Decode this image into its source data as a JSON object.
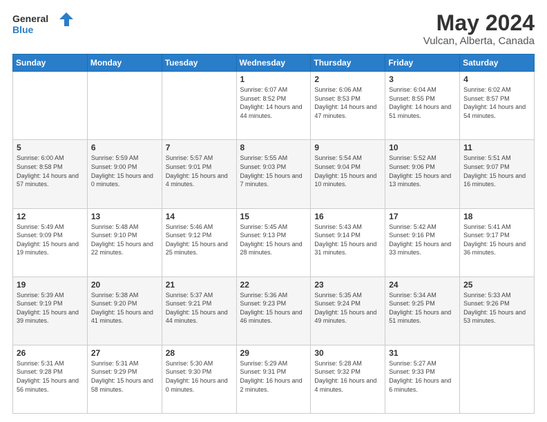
{
  "logo": {
    "line1": "General",
    "line2": "Blue"
  },
  "title": "May 2024",
  "subtitle": "Vulcan, Alberta, Canada",
  "weekdays": [
    "Sunday",
    "Monday",
    "Tuesday",
    "Wednesday",
    "Thursday",
    "Friday",
    "Saturday"
  ],
  "weeks": [
    [
      {
        "day": "",
        "sunrise": "",
        "sunset": "",
        "daylight": ""
      },
      {
        "day": "",
        "sunrise": "",
        "sunset": "",
        "daylight": ""
      },
      {
        "day": "",
        "sunrise": "",
        "sunset": "",
        "daylight": ""
      },
      {
        "day": "1",
        "sunrise": "Sunrise: 6:07 AM",
        "sunset": "Sunset: 8:52 PM",
        "daylight": "Daylight: 14 hours and 44 minutes."
      },
      {
        "day": "2",
        "sunrise": "Sunrise: 6:06 AM",
        "sunset": "Sunset: 8:53 PM",
        "daylight": "Daylight: 14 hours and 47 minutes."
      },
      {
        "day": "3",
        "sunrise": "Sunrise: 6:04 AM",
        "sunset": "Sunset: 8:55 PM",
        "daylight": "Daylight: 14 hours and 51 minutes."
      },
      {
        "day": "4",
        "sunrise": "Sunrise: 6:02 AM",
        "sunset": "Sunset: 8:57 PM",
        "daylight": "Daylight: 14 hours and 54 minutes."
      }
    ],
    [
      {
        "day": "5",
        "sunrise": "Sunrise: 6:00 AM",
        "sunset": "Sunset: 8:58 PM",
        "daylight": "Daylight: 14 hours and 57 minutes."
      },
      {
        "day": "6",
        "sunrise": "Sunrise: 5:59 AM",
        "sunset": "Sunset: 9:00 PM",
        "daylight": "Daylight: 15 hours and 0 minutes."
      },
      {
        "day": "7",
        "sunrise": "Sunrise: 5:57 AM",
        "sunset": "Sunset: 9:01 PM",
        "daylight": "Daylight: 15 hours and 4 minutes."
      },
      {
        "day": "8",
        "sunrise": "Sunrise: 5:55 AM",
        "sunset": "Sunset: 9:03 PM",
        "daylight": "Daylight: 15 hours and 7 minutes."
      },
      {
        "day": "9",
        "sunrise": "Sunrise: 5:54 AM",
        "sunset": "Sunset: 9:04 PM",
        "daylight": "Daylight: 15 hours and 10 minutes."
      },
      {
        "day": "10",
        "sunrise": "Sunrise: 5:52 AM",
        "sunset": "Sunset: 9:06 PM",
        "daylight": "Daylight: 15 hours and 13 minutes."
      },
      {
        "day": "11",
        "sunrise": "Sunrise: 5:51 AM",
        "sunset": "Sunset: 9:07 PM",
        "daylight": "Daylight: 15 hours and 16 minutes."
      }
    ],
    [
      {
        "day": "12",
        "sunrise": "Sunrise: 5:49 AM",
        "sunset": "Sunset: 9:09 PM",
        "daylight": "Daylight: 15 hours and 19 minutes."
      },
      {
        "day": "13",
        "sunrise": "Sunrise: 5:48 AM",
        "sunset": "Sunset: 9:10 PM",
        "daylight": "Daylight: 15 hours and 22 minutes."
      },
      {
        "day": "14",
        "sunrise": "Sunrise: 5:46 AM",
        "sunset": "Sunset: 9:12 PM",
        "daylight": "Daylight: 15 hours and 25 minutes."
      },
      {
        "day": "15",
        "sunrise": "Sunrise: 5:45 AM",
        "sunset": "Sunset: 9:13 PM",
        "daylight": "Daylight: 15 hours and 28 minutes."
      },
      {
        "day": "16",
        "sunrise": "Sunrise: 5:43 AM",
        "sunset": "Sunset: 9:14 PM",
        "daylight": "Daylight: 15 hours and 31 minutes."
      },
      {
        "day": "17",
        "sunrise": "Sunrise: 5:42 AM",
        "sunset": "Sunset: 9:16 PM",
        "daylight": "Daylight: 15 hours and 33 minutes."
      },
      {
        "day": "18",
        "sunrise": "Sunrise: 5:41 AM",
        "sunset": "Sunset: 9:17 PM",
        "daylight": "Daylight: 15 hours and 36 minutes."
      }
    ],
    [
      {
        "day": "19",
        "sunrise": "Sunrise: 5:39 AM",
        "sunset": "Sunset: 9:19 PM",
        "daylight": "Daylight: 15 hours and 39 minutes."
      },
      {
        "day": "20",
        "sunrise": "Sunrise: 5:38 AM",
        "sunset": "Sunset: 9:20 PM",
        "daylight": "Daylight: 15 hours and 41 minutes."
      },
      {
        "day": "21",
        "sunrise": "Sunrise: 5:37 AM",
        "sunset": "Sunset: 9:21 PM",
        "daylight": "Daylight: 15 hours and 44 minutes."
      },
      {
        "day": "22",
        "sunrise": "Sunrise: 5:36 AM",
        "sunset": "Sunset: 9:23 PM",
        "daylight": "Daylight: 15 hours and 46 minutes."
      },
      {
        "day": "23",
        "sunrise": "Sunrise: 5:35 AM",
        "sunset": "Sunset: 9:24 PM",
        "daylight": "Daylight: 15 hours and 49 minutes."
      },
      {
        "day": "24",
        "sunrise": "Sunrise: 5:34 AM",
        "sunset": "Sunset: 9:25 PM",
        "daylight": "Daylight: 15 hours and 51 minutes."
      },
      {
        "day": "25",
        "sunrise": "Sunrise: 5:33 AM",
        "sunset": "Sunset: 9:26 PM",
        "daylight": "Daylight: 15 hours and 53 minutes."
      }
    ],
    [
      {
        "day": "26",
        "sunrise": "Sunrise: 5:31 AM",
        "sunset": "Sunset: 9:28 PM",
        "daylight": "Daylight: 15 hours and 56 minutes."
      },
      {
        "day": "27",
        "sunrise": "Sunrise: 5:31 AM",
        "sunset": "Sunset: 9:29 PM",
        "daylight": "Daylight: 15 hours and 58 minutes."
      },
      {
        "day": "28",
        "sunrise": "Sunrise: 5:30 AM",
        "sunset": "Sunset: 9:30 PM",
        "daylight": "Daylight: 16 hours and 0 minutes."
      },
      {
        "day": "29",
        "sunrise": "Sunrise: 5:29 AM",
        "sunset": "Sunset: 9:31 PM",
        "daylight": "Daylight: 16 hours and 2 minutes."
      },
      {
        "day": "30",
        "sunrise": "Sunrise: 5:28 AM",
        "sunset": "Sunset: 9:32 PM",
        "daylight": "Daylight: 16 hours and 4 minutes."
      },
      {
        "day": "31",
        "sunrise": "Sunrise: 5:27 AM",
        "sunset": "Sunset: 9:33 PM",
        "daylight": "Daylight: 16 hours and 6 minutes."
      },
      {
        "day": "",
        "sunrise": "",
        "sunset": "",
        "daylight": ""
      }
    ]
  ]
}
